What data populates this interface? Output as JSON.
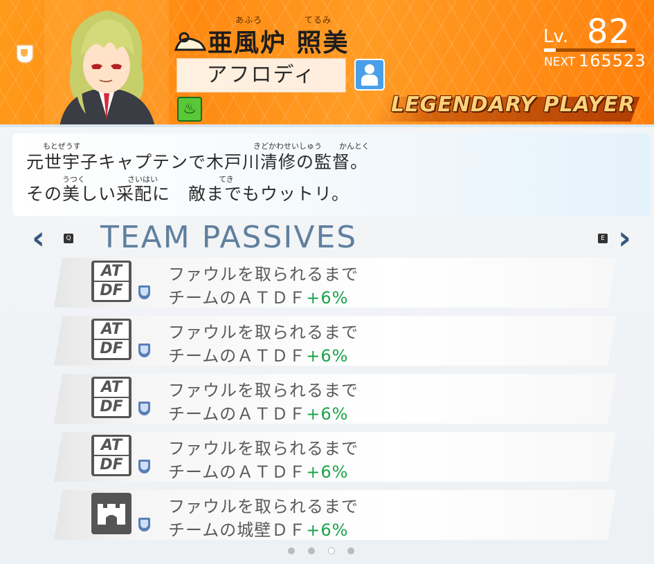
{
  "header": {
    "name_furigana_1": "あふろ",
    "name_furigana_2": "てるみ",
    "name": "亜風炉 照美",
    "nickname": "アフロディ",
    "level_label": "Lv.",
    "level_value": "82",
    "level_progress": 0.13,
    "next_label": "NEXT",
    "next_value": "165523",
    "rank_label": "LEGENDARY PLAYER",
    "element_icon": "wood-element-icon"
  },
  "description": {
    "line1": "元世宇子キャプテンで木戸川清修の監督。",
    "line2": "その美しい采配に　敵までもウットリ。",
    "ruby": {
      "motozeusu": "もとぜうす",
      "kidokawaseishuu": "きどかわせいしゅう",
      "kantoku": "かんとく",
      "utsuku": "うつく",
      "saihai": "さいはい",
      "teki": "てき"
    }
  },
  "passives": {
    "title": "TEAM PASSIVES",
    "key_left": "Q",
    "key_right": "E",
    "items": [
      {
        "badge_top": "AT",
        "badge_bottom": "DF",
        "line1": "ファウルを取られるまで",
        "line2": "チームのＡＴＤＦ",
        "bonus": "+6%"
      },
      {
        "badge_top": "AT",
        "badge_bottom": "DF",
        "line1": "ファウルを取られるまで",
        "line2": "チームのＡＴＤＦ",
        "bonus": "+6%"
      },
      {
        "badge_top": "AT",
        "badge_bottom": "DF",
        "line1": "ファウルを取られるまで",
        "line2": "チームのＡＴＤＦ",
        "bonus": "+6%"
      },
      {
        "badge_top": "AT",
        "badge_bottom": "DF",
        "line1": "ファウルを取られるまで",
        "line2": "チームのＡＴＤＦ",
        "bonus": "+6%"
      },
      {
        "badge_icon": "castle-wall-icon",
        "line1": "ファウルを取られるまで",
        "line2": "チームの城壁ＤＦ",
        "bonus": "+6%"
      }
    ]
  },
  "pagination": {
    "count": 4,
    "active": 2
  },
  "colors": {
    "header_orange": "#ff8c14",
    "bonus_green": "#19a44a",
    "title_blue": "#5f7f9e"
  }
}
